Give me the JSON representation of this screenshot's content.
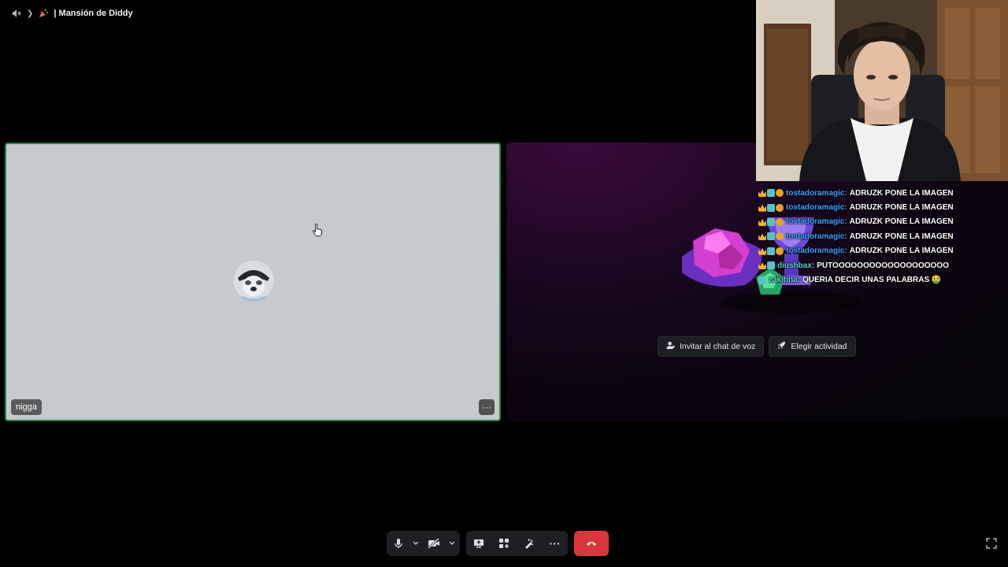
{
  "topbar": {
    "speaker_icon": "speaker-muted-icon",
    "chevron_icon": "chevron-right-icon",
    "channel_emoji_icon": "party-popper-icon",
    "channel_name": "| Mansión de Diddy"
  },
  "participant": {
    "name": "nigga",
    "avatar_icon": "dog-avatar-icon",
    "more_label": "···"
  },
  "activity": {
    "invite_label": "Invitar al chat de voz",
    "choose_label": "Elegir actividad"
  },
  "chat_overlay": {
    "lines": [
      {
        "user": "tostadoramagic:",
        "message": "ADRUZK PONE LA IMAGEN",
        "color": "#3aa0ff"
      },
      {
        "user": "tostadoramagic:",
        "message": "ADRUZK PONE LA IMAGEN",
        "color": "#3aa0ff"
      },
      {
        "user": "tostadoramagic:",
        "message": "ADRUZK PONE LA IMAGEN",
        "color": "#3aa0ff"
      },
      {
        "user": "tostadoramagic:",
        "message": "ADRUZK PONE LA IMAGEN",
        "color": "#3aa0ff"
      },
      {
        "user": "tostadoramagic:",
        "message": "ADRUZK PONE LA IMAGEN",
        "color": "#3aa0ff"
      },
      {
        "user": "diushbax:",
        "message": "PUTOOOOOOOOOOOOOOOOOOO",
        "color": "#58d7c4"
      },
      {
        "user": "zakitina:",
        "message": "QUERIA DECIR UNAS PALABRAS 🤮",
        "color": "#58d7c4"
      }
    ]
  },
  "controls": {
    "mic_icon": "microphone-icon",
    "mic_options_icon": "chevron-down-icon",
    "camera_icon": "camera-off-icon",
    "camera_options_icon": "chevron-down-icon",
    "screenshare_icon": "screen-share-icon",
    "activities_icon": "activities-icon",
    "soundboard_icon": "soundboard-icon",
    "more_icon": "more-options-icon",
    "more_label": "···",
    "leave_icon": "hang-up-icon",
    "fullscreen_icon": "fullscreen-icon"
  },
  "colors": {
    "speaking_border": "#2d7d46",
    "leave_button": "#da373c",
    "control_bg": "#1e1f22"
  }
}
